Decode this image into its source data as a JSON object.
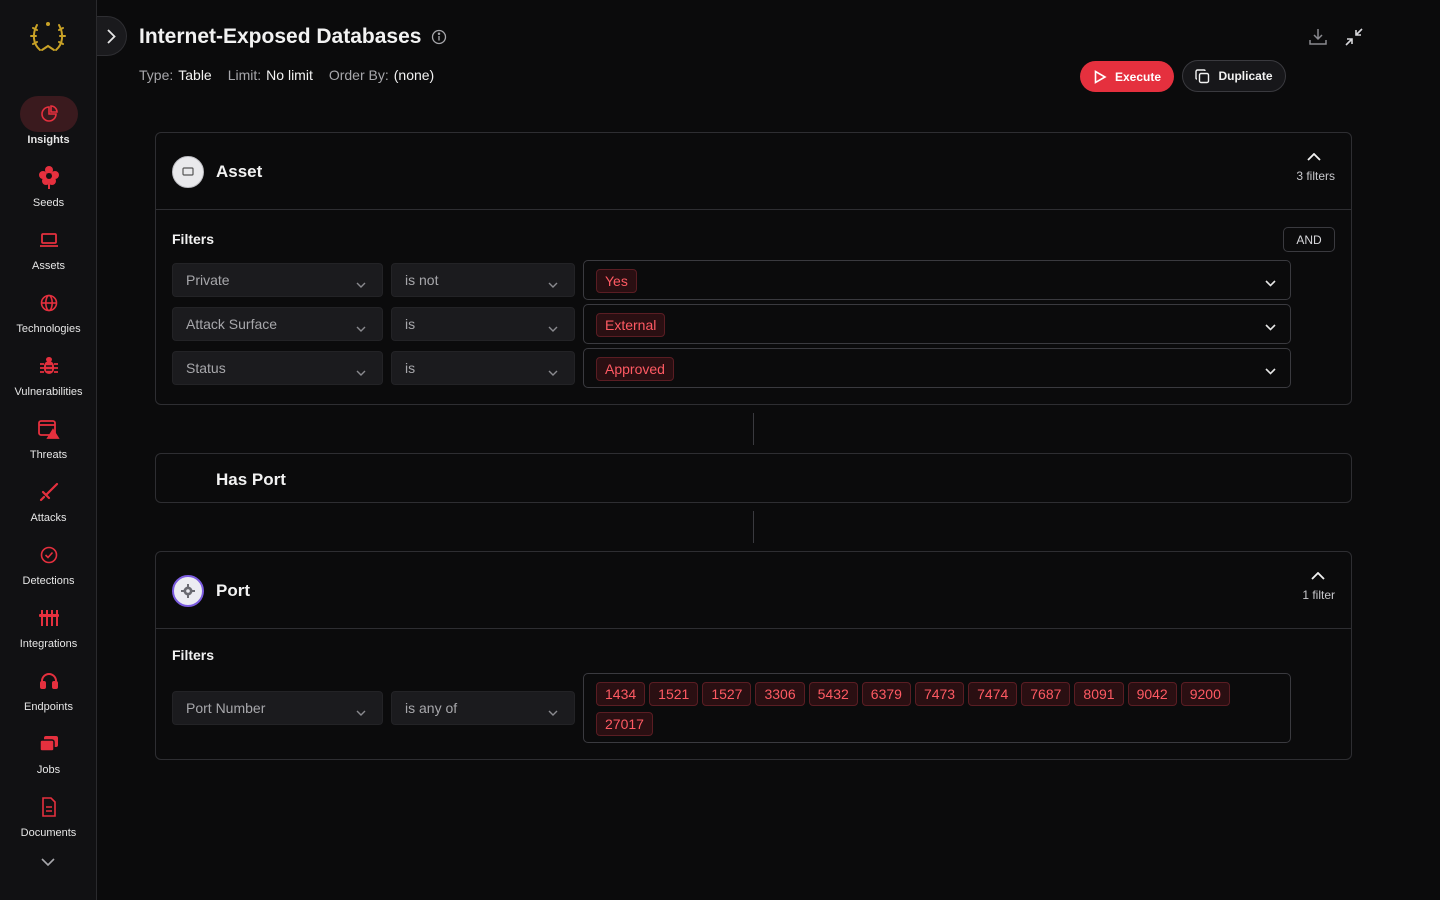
{
  "sidebar": {
    "items": [
      {
        "label": "Insights",
        "icon": "pie-chart-icon",
        "active": true
      },
      {
        "label": "Seeds",
        "icon": "flower-icon"
      },
      {
        "label": "Assets",
        "icon": "laptop-icon"
      },
      {
        "label": "Technologies",
        "icon": "globe-icon"
      },
      {
        "label": "Vulnerabilities",
        "icon": "bug-icon"
      },
      {
        "label": "Threats",
        "icon": "alert-window-icon"
      },
      {
        "label": "Attacks",
        "icon": "sword-icon"
      },
      {
        "label": "Detections",
        "icon": "check-circle-icon"
      },
      {
        "label": "Integrations",
        "icon": "sliders-icon"
      },
      {
        "label": "Endpoints",
        "icon": "headset-icon"
      },
      {
        "label": "Jobs",
        "icon": "stack-icon"
      },
      {
        "label": "Documents",
        "icon": "document-icon"
      }
    ]
  },
  "header": {
    "title": "Internet-Exposed Databases",
    "meta": [
      {
        "key": "Type:",
        "value": "Table"
      },
      {
        "key": "Limit:",
        "value": "No limit"
      },
      {
        "key": "Order By:",
        "value": "(none)"
      }
    ],
    "execute_label": "Execute",
    "duplicate_label": "Duplicate"
  },
  "asset_card": {
    "title": "Asset",
    "filter_count": "3 filters",
    "filters_label": "Filters",
    "logic": "AND",
    "rows": [
      {
        "field": "Private",
        "op": "is not",
        "value": "Yes"
      },
      {
        "field": "Attack Surface",
        "op": "is",
        "value": "External"
      },
      {
        "field": "Status",
        "op": "is",
        "value": "Approved"
      }
    ]
  },
  "relation": {
    "title": "Has Port"
  },
  "port_card": {
    "title": "Port",
    "filter_count": "1 filter",
    "filters_label": "Filters",
    "rows": [
      {
        "field": "Port Number",
        "op": "is any of",
        "values": [
          "1434",
          "1521",
          "1527",
          "3306",
          "5432",
          "6379",
          "7473",
          "7474",
          "7687",
          "8091",
          "9042",
          "9200",
          "27017"
        ]
      }
    ]
  },
  "colors": {
    "accent": "#e5303e",
    "tag_text": "#ff5a63",
    "logo_gold": "#c9a227"
  }
}
